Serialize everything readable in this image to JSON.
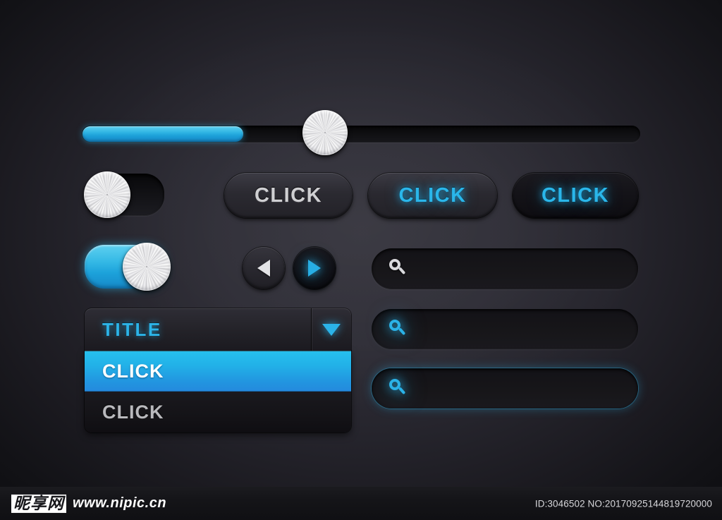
{
  "slider": {
    "name": "volume-slider",
    "value_percent": 29,
    "fill_color": "#2ab0e0",
    "track_color": "#101013"
  },
  "toggles": [
    {
      "name": "toggle-off",
      "state": "off",
      "label": ""
    },
    {
      "name": "toggle-on",
      "state": "on",
      "label": "",
      "accent": "#2ab4e6"
    }
  ],
  "buttons": [
    {
      "label": "CLICK",
      "style": "grey",
      "color": "#cfcfd2"
    },
    {
      "label": "CLICK",
      "style": "grey-blue-text",
      "color": "#2ab6ea"
    },
    {
      "label": "CLICK",
      "style": "dark-blue-text",
      "color": "#2ab6ea"
    }
  ],
  "arrows": {
    "prev": {
      "icon": "triangle-left-icon",
      "color": "#e3e3e6"
    },
    "next": {
      "icon": "triangle-right-icon",
      "color": "#27aee4"
    }
  },
  "dropdown": {
    "title": "TITLE",
    "caret_icon": "chevron-down-icon",
    "accent": "#2cb4e8",
    "items": [
      {
        "label": "CLICK",
        "selected": true
      },
      {
        "label": "CLICK",
        "selected": false
      }
    ]
  },
  "search_fields": [
    {
      "icon": "search-icon",
      "icon_color": "#d9d9dd",
      "value": "",
      "placeholder": ""
    },
    {
      "icon": "search-icon",
      "icon_color": "#2bb2e7",
      "value": "",
      "placeholder": ""
    },
    {
      "icon": "search-icon",
      "icon_color": "#2bb2e7",
      "value": "",
      "placeholder": "",
      "focused": true
    }
  ],
  "footer": {
    "watermark_cn": "昵享网",
    "watermark_url": "www.nipic.cn",
    "id_text": "ID:3046502 NO:20170925144819720000"
  },
  "theme": {
    "background_center": "#35343d",
    "background_edge": "#0a0a0d",
    "accent": "#2ab4e6"
  }
}
